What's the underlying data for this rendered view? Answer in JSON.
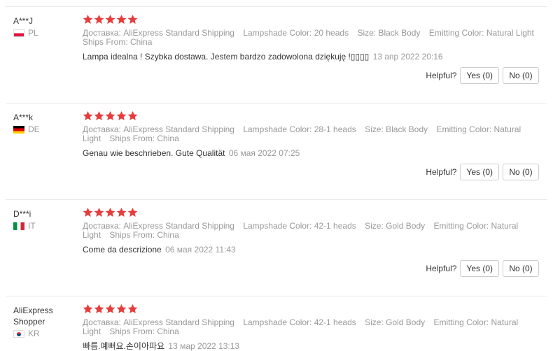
{
  "helpful_label": "Helpful?",
  "star_color": "#e63c3c",
  "reviews": [
    {
      "user": "A***J",
      "country": "PL",
      "flag": "poland-flag-icon",
      "rating": 5,
      "attributes": {
        "shipping": "Доставка: AliExpress Standard Shipping",
        "lampshade": "Lampshade Color: 20 heads",
        "size": "Size: Black Body",
        "emitting": "Emitting Color: Natural Light",
        "ships_from": "Ships From: China"
      },
      "text": "Lampa idealna ! Szybka dostawa. Jestem bardzo zadowolona dziękuję !▯▯▯▯",
      "date": "13 апр 2022 20:16",
      "yes": "Yes (0)",
      "no": "No (0)"
    },
    {
      "user": "A***k",
      "country": "DE",
      "flag": "germany-flag-icon",
      "rating": 5,
      "attributes": {
        "shipping": "Доставка: AliExpress Standard Shipping",
        "lampshade": "Lampshade Color: 28-1 heads",
        "size": "Size: Black Body",
        "emitting": "Emitting Color: Natural Light",
        "ships_from": "Ships From: China"
      },
      "text": "Genau wie beschrieben. Gute Qualität",
      "date": "06 мая 2022 07:25",
      "yes": "Yes (0)",
      "no": "No (0)"
    },
    {
      "user": "D***i",
      "country": "IT",
      "flag": "italy-flag-icon",
      "rating": 5,
      "attributes": {
        "shipping": "Доставка: AliExpress Standard Shipping",
        "lampshade": "Lampshade Color: 42-1 heads",
        "size": "Size: Gold Body",
        "emitting": "Emitting Color: Natural Light",
        "ships_from": "Ships From: China"
      },
      "text": "Come da descrizione",
      "date": "06 мая 2022 11:43",
      "yes": "Yes (0)",
      "no": "No (0)"
    },
    {
      "user": "AliExpress Shopper",
      "country": "KR",
      "flag": "korea-flag-icon",
      "rating": 5,
      "attributes": {
        "shipping": "Доставка: AliExpress Standard Shipping",
        "lampshade": "Lampshade Color: 42-1 heads",
        "size": "Size: Gold Body",
        "emitting": "Emitting Color: Natural Light",
        "ships_from": "Ships From: China"
      },
      "text": "빠름.예뻐요.손이아파요",
      "date": "13 мар 2022 13:13"
    }
  ]
}
